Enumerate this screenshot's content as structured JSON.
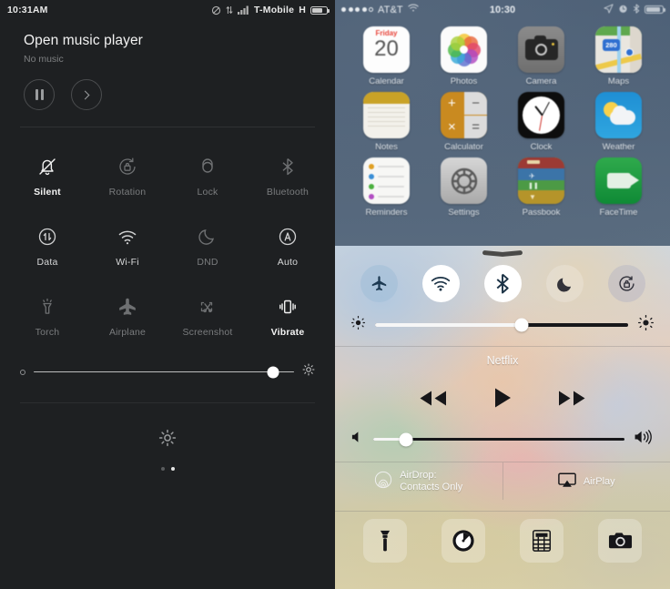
{
  "android": {
    "status": {
      "time": "10:31AM",
      "carrier": "T-Mobile",
      "network": "H",
      "icons": [
        "dnd-slash-icon",
        "data-transfer-icon",
        "signal-bars-icon",
        "battery-icon"
      ]
    },
    "player": {
      "title": "Open music player",
      "subtitle": "No music",
      "pause_label": "pause-button",
      "next_label": "next-button"
    },
    "toggles": [
      {
        "label": "Silent",
        "icon": "bell-slash-icon",
        "state": "on"
      },
      {
        "label": "Rotation",
        "icon": "rotation-lock-icon",
        "state": "off"
      },
      {
        "label": "Lock",
        "icon": "lock-icon",
        "state": "off"
      },
      {
        "label": "Bluetooth",
        "icon": "bluetooth-icon",
        "state": "off"
      },
      {
        "label": "Data",
        "icon": "data-arrows-icon",
        "state": "mid"
      },
      {
        "label": "Wi-Fi",
        "icon": "wifi-icon",
        "state": "mid"
      },
      {
        "label": "DND",
        "icon": "moon-icon",
        "state": "off"
      },
      {
        "label": "Auto",
        "icon": "auto-brightness-icon",
        "state": "mid"
      },
      {
        "label": "Torch",
        "icon": "torch-icon",
        "state": "off"
      },
      {
        "label": "Airplane",
        "icon": "airplane-icon",
        "state": "off"
      },
      {
        "label": "Screenshot",
        "icon": "screenshot-icon",
        "state": "off"
      },
      {
        "label": "Vibrate",
        "icon": "vibrate-icon",
        "state": "on"
      }
    ],
    "brightness": {
      "value": 92,
      "min_icon": "brightness-low-icon",
      "max_icon": "brightness-high-icon"
    },
    "settings_icon": "gear-icon",
    "page_dots": {
      "count": 2,
      "active": 1
    }
  },
  "ios": {
    "status": {
      "carrier": "AT&T",
      "time": "10:30",
      "signal_dots": 5,
      "signal_filled": 4,
      "icons": [
        "wifi-icon",
        "location-arrow-icon",
        "alarm-clock-icon",
        "bluetooth-icon",
        "battery-icon"
      ]
    },
    "apps": [
      {
        "label": "Calendar",
        "icon": "calendar-app-icon",
        "day_name": "Friday",
        "day_num": "20"
      },
      {
        "label": "Photos",
        "icon": "photos-app-icon"
      },
      {
        "label": "Camera",
        "icon": "camera-app-icon"
      },
      {
        "label": "Maps",
        "icon": "maps-app-icon",
        "badge": "280"
      },
      {
        "label": "Notes",
        "icon": "notes-app-icon"
      },
      {
        "label": "Calculator",
        "icon": "calculator-app-icon",
        "keys": [
          "+",
          "−",
          "×",
          "="
        ]
      },
      {
        "label": "Clock",
        "icon": "clock-app-icon"
      },
      {
        "label": "Weather",
        "icon": "weather-app-icon"
      },
      {
        "label": "Reminders",
        "icon": "reminders-app-icon"
      },
      {
        "label": "Settings",
        "icon": "settings-app-icon"
      },
      {
        "label": "Passbook",
        "icon": "passbook-app-icon"
      },
      {
        "label": "FaceTime",
        "icon": "facetime-app-icon"
      }
    ],
    "control_center": {
      "grabber": "grabber-handle",
      "toggles": [
        {
          "name": "airplane-mode-toggle",
          "icon": "airplane-icon",
          "state": "off-tinted"
        },
        {
          "name": "wifi-toggle",
          "icon": "wifi-icon",
          "state": "on"
        },
        {
          "name": "bluetooth-toggle",
          "icon": "bluetooth-icon",
          "state": "on"
        },
        {
          "name": "do-not-disturb-toggle",
          "icon": "moon-icon",
          "state": "off"
        },
        {
          "name": "rotation-lock-toggle",
          "icon": "rotation-lock-icon",
          "state": "off-tinted"
        }
      ],
      "brightness": {
        "value": 58,
        "min_icon": "brightness-low-icon",
        "max_icon": "brightness-high-icon"
      },
      "media": {
        "track": "Netflix",
        "prev": "rewind-button",
        "play": "play-button",
        "next": "fast-forward-button"
      },
      "volume": {
        "value": 13,
        "min_icon": "volume-mute-icon",
        "max_icon": "volume-high-icon"
      },
      "airdrop": {
        "icon": "airdrop-icon",
        "line1": "AirDrop:",
        "line2": "Contacts Only"
      },
      "airplay": {
        "icon": "airplay-icon",
        "label": "AirPlay"
      },
      "shortcuts": [
        {
          "name": "flashlight-shortcut",
          "icon": "flashlight-icon"
        },
        {
          "name": "timer-shortcut",
          "icon": "timer-icon"
        },
        {
          "name": "calculator-shortcut",
          "icon": "calculator-icon"
        },
        {
          "name": "camera-shortcut",
          "icon": "camera-icon"
        }
      ]
    }
  },
  "colors": {
    "android_bg": "#1e2022",
    "ios_wall": "#5b6d80",
    "accent_white": "#ffffff"
  }
}
